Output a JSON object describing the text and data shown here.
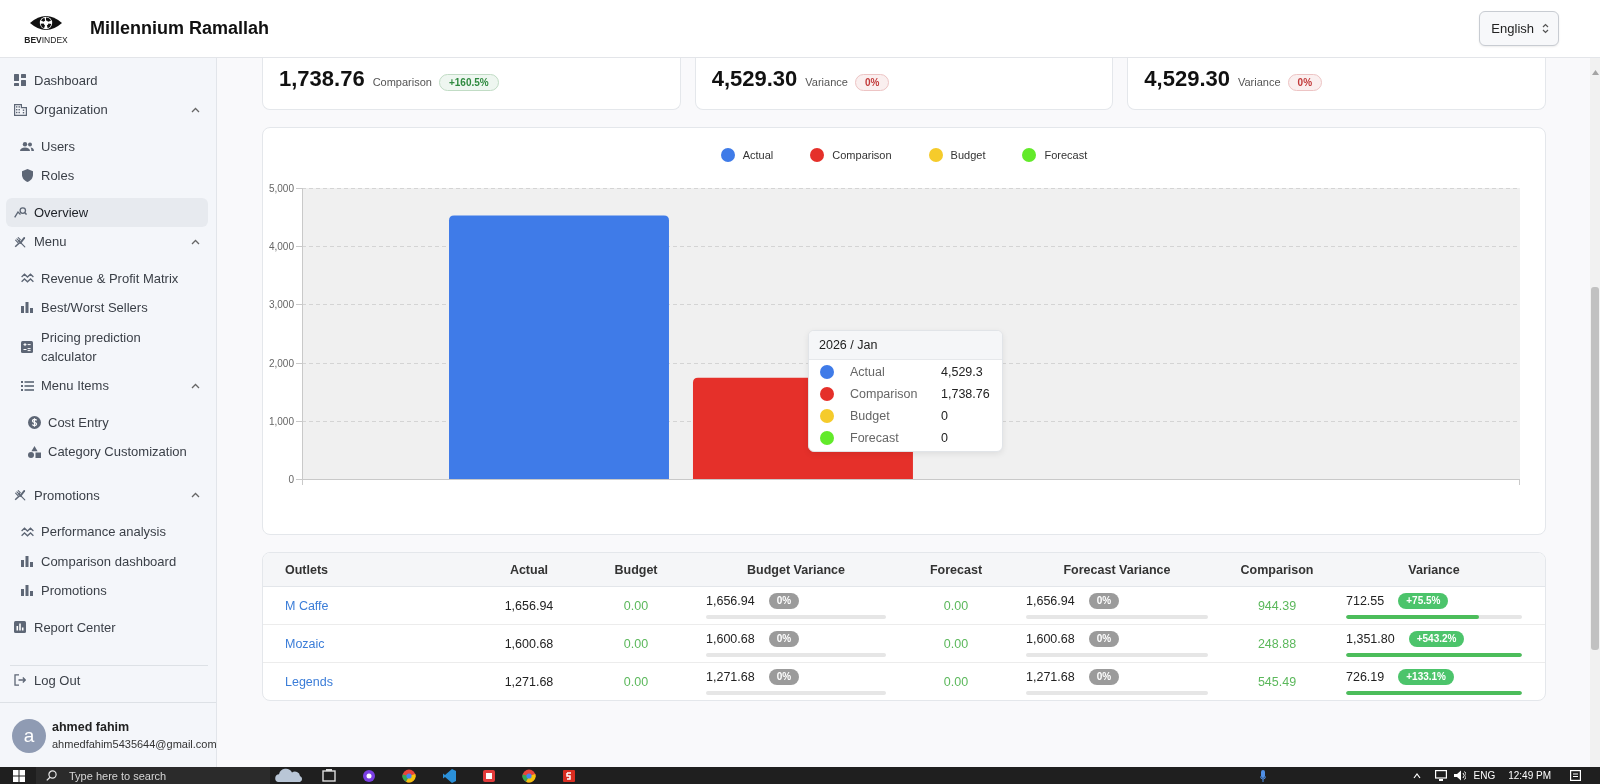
{
  "header": {
    "logo": {
      "text": "**BEV**INDEX"
    },
    "title": "Millennium Ramallah",
    "language": {
      "value": "English"
    }
  },
  "sidebar": {
    "items": [
      {
        "label": "Dashboard",
        "selected": false
      },
      {
        "label": "Organization",
        "selected": false,
        "expanded": true,
        "children": [
          {
            "label": "Users",
            "selected": false
          },
          {
            "label": "Roles",
            "selected": false
          }
        ]
      },
      {
        "label": "Overview",
        "selected": true
      },
      {
        "label": "Menu",
        "selected": false,
        "expanded": true,
        "children": [
          {
            "label": "Revenue & Profit Matrix",
            "selected": false
          },
          {
            "label": "Best/Worst Sellers",
            "selected": false
          },
          {
            "label": "Pricing prediction calculator",
            "selected": false
          },
          {
            "label": "Menu Items",
            "selected": false,
            "expanded": true,
            "children": [
              {
                "label": "Cost Entry",
                "selected": false
              },
              {
                "label": "Category Customization",
                "selected": false
              }
            ]
          }
        ]
      },
      {
        "label": "Promotions",
        "selected": false,
        "expanded": true,
        "children": [
          {
            "label": "Performance analysis",
            "selected": false
          },
          {
            "label": "Comparison dashboard",
            "selected": false
          },
          {
            "label": "Promotions",
            "selected": false
          }
        ]
      },
      {
        "label": "Report Center",
        "selected": false
      }
    ],
    "logout": {
      "label": "Log Out"
    },
    "user": {
      "avatar": "a",
      "name": "ahmed fahim",
      "email": "ahmedfahim5435644@gmail.com"
    }
  },
  "summary_cards": [
    {
      "value": "1,738.76",
      "label": "Comparison",
      "badge": {
        "text": "+160.5%",
        "color": "#2f8a3f"
      }
    },
    {
      "value": "4,529.30",
      "label": "Variance",
      "badge": {
        "text": "0%",
        "color": "#c23a3a"
      }
    },
    {
      "value": "4,529.30",
      "label": "Variance",
      "badge": {
        "text": "0%",
        "color": "#c23a3a"
      }
    }
  ],
  "chart": {
    "chart_data": {
      "type": "bar",
      "series": [
        {
          "name": "Actual",
          "color": "#3f7be8",
          "values": [
            4529.3
          ]
        },
        {
          "name": "Comparison",
          "color": "#e5302a",
          "values": [
            1738.76
          ]
        },
        {
          "name": "Budget",
          "color": "#f5cb2b",
          "values": [
            0
          ]
        },
        {
          "name": "Forecast",
          "color": "#62ea2a",
          "values": [
            0
          ]
        }
      ],
      "ylim": [
        0,
        5000
      ],
      "yticks": [
        {
          "value": 0,
          "label": "0"
        },
        {
          "value": 1000,
          "label": "1,000"
        },
        {
          "value": 2000,
          "label": "2,000"
        },
        {
          "value": 3000,
          "label": "3,000"
        },
        {
          "value": 4000,
          "label": "4,000"
        },
        {
          "value": 5000,
          "label": "5,000"
        }
      ],
      "grid": true
    },
    "tooltip": {
      "title": "2026 / Jan",
      "rows": [
        {
          "name": "Actual",
          "value": "4,529.3",
          "color": "#3f7be8"
        },
        {
          "name": "Comparison",
          "value": "1,738.76",
          "color": "#e5302a"
        },
        {
          "name": "Budget",
          "value": "0",
          "color": "#f5cb2b"
        },
        {
          "name": "Forecast",
          "value": "0",
          "color": "#62ea2a"
        }
      ]
    }
  },
  "table": {
    "columns": [
      "Outlets",
      "Actual",
      "Budget",
      "Budget Variance",
      "Forecast",
      "Forecast Variance",
      "Comparison",
      "Variance"
    ],
    "rows": [
      {
        "outlet": "M Caffe",
        "actual": "1,656.94",
        "budget": "0.00",
        "budget_variance": {
          "value": "1,656.94",
          "badge": {
            "text": "0%",
            "color": "#9b9b9b"
          },
          "level": 0
        },
        "forecast": "0.00",
        "forecast_variance": {
          "value": "1,656.94",
          "badge": {
            "text": "0%",
            "color": "#9b9b9b"
          },
          "level": 0
        },
        "comparison": "944.39",
        "variance": {
          "value": "712.55",
          "badge": {
            "text": "+75.5%",
            "color": "#4cc46b"
          },
          "level": 0.755
        }
      },
      {
        "outlet": "Mozaic",
        "actual": "1,600.68",
        "budget": "0.00",
        "budget_variance": {
          "value": "1,600.68",
          "badge": {
            "text": "0%",
            "color": "#9b9b9b"
          },
          "level": 0
        },
        "forecast": "0.00",
        "forecast_variance": {
          "value": "1,600.68",
          "badge": {
            "text": "0%",
            "color": "#9b9b9b"
          },
          "level": 0
        },
        "comparison": "248.88",
        "variance": {
          "value": "1,351.80",
          "badge": {
            "text": "+543.2%",
            "color": "#4cc46b"
          },
          "level": 1
        }
      },
      {
        "outlet": "Legends",
        "actual": "1,271.68",
        "budget": "0.00",
        "budget_variance": {
          "value": "1,271.68",
          "badge": {
            "text": "0%",
            "color": "#9b9b9b"
          },
          "level": 0
        },
        "forecast": "0.00",
        "forecast_variance": {
          "value": "1,271.68",
          "badge": {
            "text": "0%",
            "color": "#9b9b9b"
          },
          "level": 0
        },
        "comparison": "545.49",
        "variance": {
          "value": "726.19",
          "badge": {
            "text": "+133.1%",
            "color": "#4cc46b"
          },
          "level": 1
        }
      }
    ]
  },
  "taskbar": {
    "search": {
      "placeholder": "Type here to search"
    },
    "language": "ENG",
    "time": "12:49 PM"
  }
}
